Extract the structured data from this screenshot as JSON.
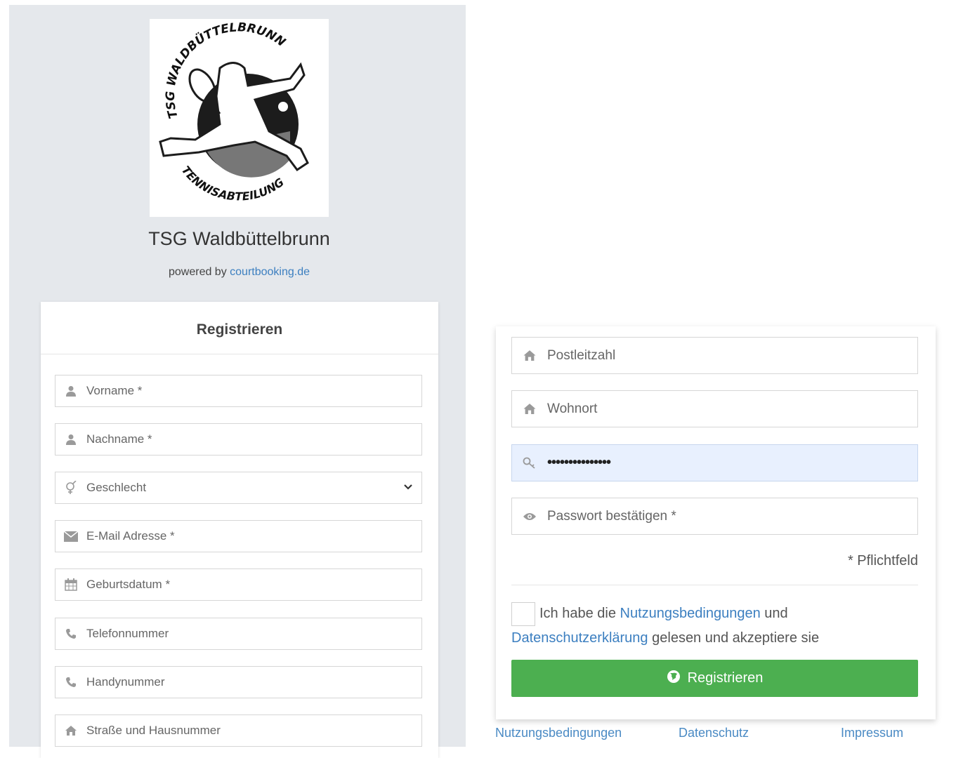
{
  "header": {
    "club_name": "TSG Waldbüttelbrunn",
    "powered_prefix": "powered by",
    "powered_link": "courtbooking.de",
    "logo_top_text": "TSG WALDBÜTTELBRUNN",
    "logo_bottom_text": "TENNISABTEILUNG"
  },
  "form": {
    "title": "Registrieren",
    "fields_left": [
      {
        "label": "Vorname *",
        "icon": "user-icon"
      },
      {
        "label": "Nachname *",
        "icon": "user-icon"
      },
      {
        "label": "Geschlecht",
        "icon": "gender-icon"
      },
      {
        "label": "E-Mail Adresse *",
        "icon": "envelope-icon"
      },
      {
        "label": "Geburtsdatum *",
        "icon": "calendar-icon"
      },
      {
        "label": "Telefonnummer",
        "icon": "phone-icon"
      },
      {
        "label": "Handynummer",
        "icon": "phone-icon"
      },
      {
        "label": "Straße und Hausnummer",
        "icon": "home-icon"
      }
    ],
    "fields_right": [
      {
        "label": "Postleitzahl",
        "icon": "home-icon"
      },
      {
        "label": "Wohnort",
        "icon": "home-icon"
      },
      {
        "value": "•••••••••••••••",
        "icon": "key-icon"
      },
      {
        "label": "Passwort bestätigen *",
        "icon": "eye-icon"
      }
    ],
    "required_note": "* Pflichtfeld",
    "agree": {
      "prefix": "Ich habe die",
      "link1": "Nutzungsbedingungen",
      "middle": "und",
      "link2": "Datenschutzerklärung",
      "suffix": "gelesen und akzeptiere sie"
    },
    "submit_label": "Registrieren"
  },
  "footer": {
    "links": [
      "Nutzungsbedingungen",
      "Datenschutz",
      "Impressum"
    ]
  },
  "colors": {
    "panel_bg": "#e5e8ec",
    "link": "#3c7fc0",
    "button": "#4caf50",
    "autofill": "#e8f0fe"
  }
}
